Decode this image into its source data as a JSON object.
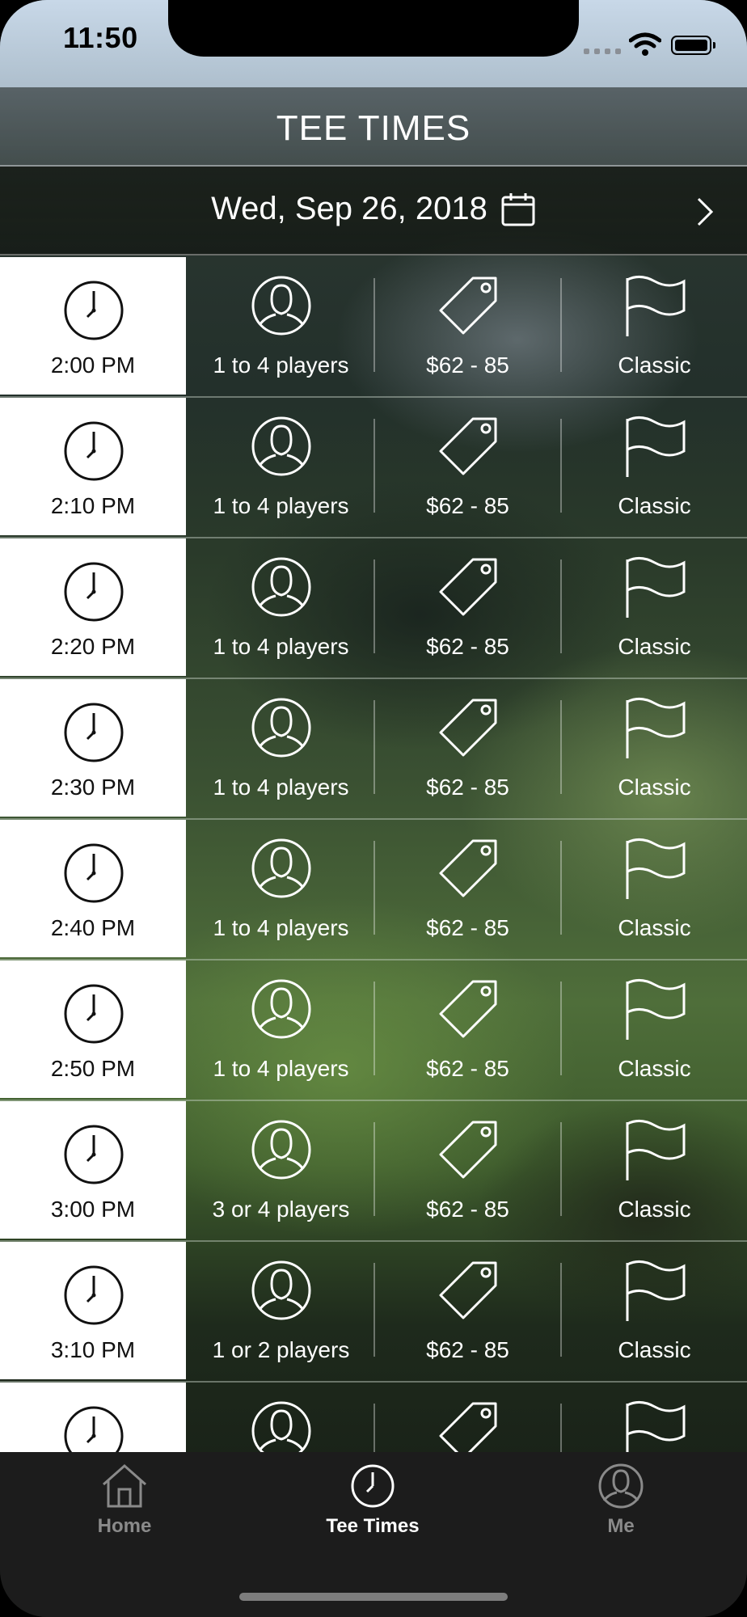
{
  "status_bar": {
    "time": "11:50"
  },
  "header": {
    "title": "TEE TIMES"
  },
  "date_bar": {
    "date": "Wed, Sep 26, 2018"
  },
  "tee_times": [
    {
      "time": "2:00 PM",
      "players": "1 to 4 players",
      "price": "$62 - 85",
      "course": "Classic"
    },
    {
      "time": "2:10 PM",
      "players": "1 to 4 players",
      "price": "$62 - 85",
      "course": "Classic"
    },
    {
      "time": "2:20 PM",
      "players": "1 to 4 players",
      "price": "$62 - 85",
      "course": "Classic"
    },
    {
      "time": "2:30 PM",
      "players": "1 to 4 players",
      "price": "$62 - 85",
      "course": "Classic"
    },
    {
      "time": "2:40 PM",
      "players": "1 to 4 players",
      "price": "$62 - 85",
      "course": "Classic"
    },
    {
      "time": "2:50 PM",
      "players": "1 to 4 players",
      "price": "$62 - 85",
      "course": "Classic"
    },
    {
      "time": "3:00 PM",
      "players": "3 or 4 players",
      "price": "$62 - 85",
      "course": "Classic"
    },
    {
      "time": "3:10 PM",
      "players": "1 or 2 players",
      "price": "$62 - 85",
      "course": "Classic"
    },
    {
      "time": "",
      "players": "",
      "price": "",
      "course": ""
    }
  ],
  "tabs": [
    {
      "label": "Home",
      "icon": "home-icon",
      "active": false
    },
    {
      "label": "Tee Times",
      "icon": "clock-icon",
      "active": true
    },
    {
      "label": "Me",
      "icon": "person-icon",
      "active": false
    }
  ],
  "colors": {
    "active_tab": "#ffffff",
    "inactive_tab": "#8a8a8a",
    "tab_bar": "#1c1c1c",
    "time_cell": "#ffffff"
  }
}
